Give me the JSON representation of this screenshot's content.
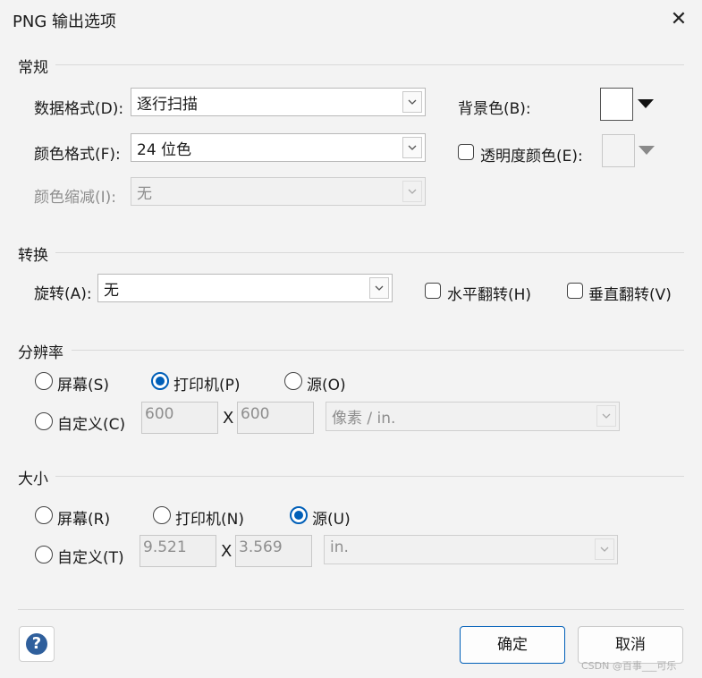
{
  "window": {
    "title": "PNG 输出选项",
    "close_glyph": "✕"
  },
  "general": {
    "heading": "常规",
    "data_format_label": "数据格式(D):",
    "data_format_value": "逐行扫描",
    "color_format_label": "颜色格式(F):",
    "color_format_value": "24 位色",
    "color_reduction_label": "颜色缩减(I):",
    "color_reduction_value": "无",
    "background_label": "背景色(B):",
    "background_color": "#ffffff",
    "transparency_label": "透明度颜色(E):",
    "transparency_checked": false
  },
  "transform": {
    "heading": "转换",
    "rotate_label": "旋转(A):",
    "rotate_value": "无",
    "flip_h_label": "水平翻转(H)",
    "flip_h_checked": false,
    "flip_v_label": "垂直翻转(V)",
    "flip_v_checked": false
  },
  "resolution": {
    "heading": "分辨率",
    "screen_label": "屏幕(S)",
    "printer_label": "打印机(P)",
    "source_label": "源(O)",
    "custom_label": "自定义(C)",
    "selected": "printer",
    "x_value": "600",
    "x_sep": "X",
    "y_value": "600",
    "unit_value": "像素 / in."
  },
  "size": {
    "heading": "大小",
    "screen_label": "屏幕(R)",
    "printer_label": "打印机(N)",
    "source_label": "源(U)",
    "custom_label": "自定义(T)",
    "selected": "source",
    "width_value": "9.521",
    "x_sep": "X",
    "height_value": "3.569",
    "unit_value": "in."
  },
  "footer": {
    "help_glyph": "?",
    "ok_label": "确定",
    "cancel_label": "取消",
    "watermark": "CSDN @百事___可乐"
  },
  "colors": {
    "accent": "#005fb8",
    "help_icon": "#2f5f9c"
  }
}
